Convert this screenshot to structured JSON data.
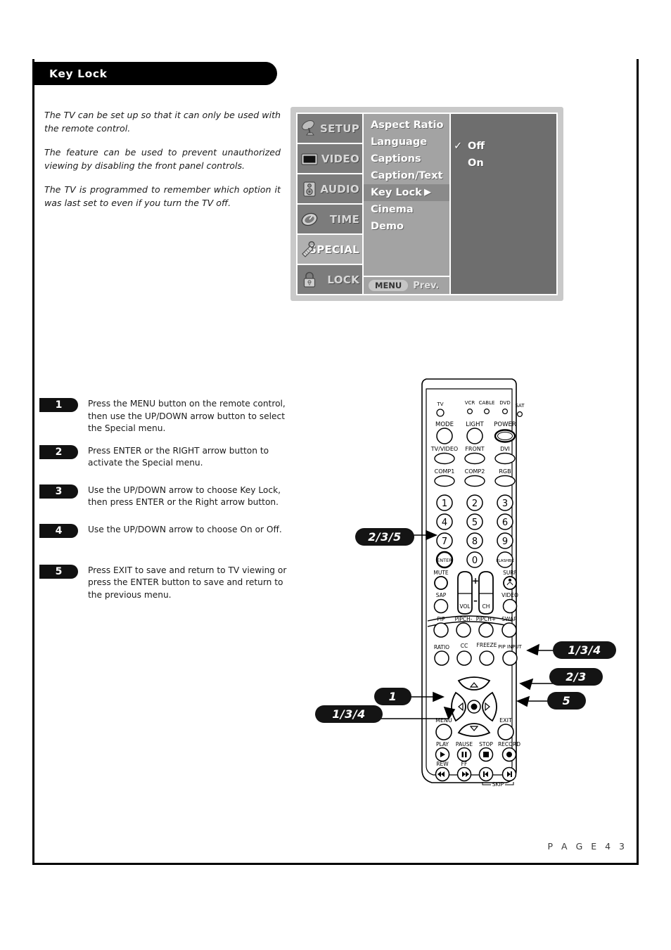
{
  "page": {
    "title": "Key Lock",
    "footer": "P A G E   4 3"
  },
  "intro": {
    "p1": "The TV can be set up so that it can only be used with the remote control.",
    "p2": "The feature can be used to prevent unauthorized viewing by disabling the front panel controls.",
    "p3": "The TV is programmed to remember which option it was last set to even if you turn the TV off."
  },
  "osd": {
    "sidebar": [
      {
        "label": "SETUP",
        "icon": "satellite-dish-icon",
        "active": false
      },
      {
        "label": "VIDEO",
        "icon": "tv-screen-icon",
        "active": false
      },
      {
        "label": "AUDIO",
        "icon": "speaker-icon",
        "active": false
      },
      {
        "label": "TIME",
        "icon": "clock-icon",
        "active": false
      },
      {
        "label": "SPECIAL",
        "icon": "tag-icon",
        "active": true
      },
      {
        "label": "LOCK",
        "icon": "padlock-icon",
        "active": false
      }
    ],
    "menu_items": [
      {
        "label": "Aspect Ratio",
        "selected": false,
        "arrow": ""
      },
      {
        "label": "Language",
        "selected": false,
        "arrow": ""
      },
      {
        "label": "Captions",
        "selected": false,
        "arrow": ""
      },
      {
        "label": "Caption/Text",
        "selected": false,
        "arrow": ""
      },
      {
        "label": "Key Lock",
        "selected": true,
        "arrow": "▶"
      },
      {
        "label": "Cinema",
        "selected": false,
        "arrow": ""
      },
      {
        "label": "Demo",
        "selected": false,
        "arrow": ""
      }
    ],
    "footer": {
      "menu_key": "MENU",
      "prev_label": "Prev."
    },
    "options": [
      {
        "label": "Off",
        "checked": true,
        "check": "✓"
      },
      {
        "label": "On",
        "checked": false,
        "check": ""
      }
    ],
    "colors": {
      "panel_bg": "#c9c9c9",
      "sidebar_bg": "#7c7c7c",
      "sidebar_active": "#b0b0b0",
      "menu_bg": "#a3a3a3",
      "menu_selected": "#8a8a8a",
      "options_bg": "#6e6e6e"
    }
  },
  "steps": [
    {
      "number": "1",
      "text": "Press the MENU button on the remote control, then use the UP/DOWN arrow button to select the Special menu."
    },
    {
      "number": "2",
      "text": "Press ENTER or the RIGHT arrow button to activate the Special menu."
    },
    {
      "number": "3",
      "text": "Use the UP/DOWN arrow to choose Key Lock, then press ENTER or the Right arrow button."
    },
    {
      "number": "4",
      "text": "Use the UP/DOWN arrow to  choose On or Off."
    },
    {
      "number": "5",
      "text": "Press EXIT to save and return to TV viewing or press the ENTER button to save and return to the previous menu."
    }
  ],
  "callouts": [
    {
      "id": "enter",
      "label": "2/3/5",
      "target": "enter-button"
    },
    {
      "id": "up-arrow",
      "label": "1/3/4",
      "target": "up-arrow-button"
    },
    {
      "id": "right-arrow",
      "label": "2/3",
      "target": "right-arrow-button"
    },
    {
      "id": "exit",
      "label": "5",
      "target": "exit-button"
    },
    {
      "id": "menu",
      "label": "1",
      "target": "menu-button"
    },
    {
      "id": "down-arrow",
      "label": "1/3/4",
      "target": "down-arrow-button"
    }
  ],
  "remote": {
    "leds": [
      "TV",
      "VCR",
      "CABLE",
      "DVD",
      "SAT"
    ],
    "row_mode": [
      "MODE",
      "LIGHT",
      "POWER"
    ],
    "row_input1": [
      "TV/VIDEO",
      "FRONT",
      "DVI"
    ],
    "row_input2": [
      "COMP1",
      "COMP2",
      "RGB"
    ],
    "keypad": [
      "1",
      "2",
      "3",
      "4",
      "5",
      "6",
      "7",
      "8",
      "9"
    ],
    "keypad_bottom": [
      "ENTER",
      "0",
      "FLASHBK"
    ],
    "row_mute": [
      "MUTE",
      "SURF"
    ],
    "row_sap": [
      "SAP",
      "VIDEO"
    ],
    "rockers": [
      "VOL",
      "CH"
    ],
    "rocker_marks": [
      "+",
      "–"
    ],
    "row_pip": [
      "PIP",
      "PIPCH-",
      "PIPCH+",
      "SWAP"
    ],
    "row_ratio": [
      "RATIO",
      "CC",
      "FREEZE",
      "PIP INPUT"
    ],
    "row_menu": [
      "MENU",
      "EXIT"
    ],
    "row_trans": [
      "PLAY",
      "PAUSE",
      "STOP",
      "RECORD"
    ],
    "row_trans2": [
      "REW",
      "FF"
    ],
    "skip_label": "SKIP"
  }
}
